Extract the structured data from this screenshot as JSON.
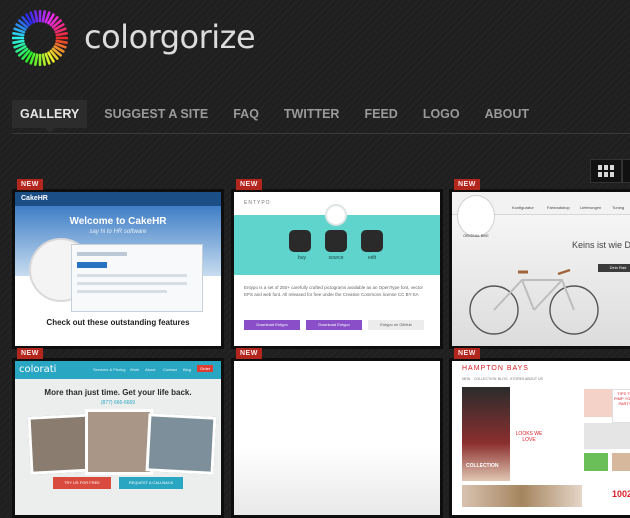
{
  "site": {
    "title": "colorgorize"
  },
  "nav": {
    "items": [
      {
        "label": "GALLERY",
        "active": true
      },
      {
        "label": "SUGGEST A SITE"
      },
      {
        "label": "FAQ"
      },
      {
        "label": "TWITTER"
      },
      {
        "label": "FEED"
      },
      {
        "label": "LOGO"
      },
      {
        "label": "ABOUT"
      }
    ]
  },
  "gallery": {
    "badge": "NEW",
    "items": [
      {
        "site": "CakeHR",
        "brand": "CakeHR",
        "heading": "Welcome to CakeHR",
        "tagline": "say hi to HR software",
        "caption": "Check out these outstanding features",
        "caption_highlight": "outstanding"
      },
      {
        "site": "Entypo",
        "nav": "ENTYPO",
        "labels": [
          "buy",
          "source",
          "edit"
        ],
        "body": "Entypo is a set of 250+ carefully crafted pictograms available as an OpenType font, vector EPS and web font. All released for free under the Creative Commons license CC BY-SA",
        "buttons": [
          "Download Entypo",
          "Download Entypo",
          "Entypo on GitHub"
        ]
      },
      {
        "site": "Keins ist wie Der",
        "headline": "Keins ist wie De",
        "menu": [
          "Konfigurator",
          "Fahrradshop",
          "Lieferungen",
          "Tuning"
        ],
        "button": "Dein Rad",
        "circle_text": "ORIGINAL BIKE"
      },
      {
        "site": "Colorati",
        "brand": "colorati",
        "nav": [
          "Services & Pricing",
          "Work",
          "About",
          "Contact",
          "Blog",
          "Order"
        ],
        "headline": "More than just time. Get your life back.",
        "phone": "(877) 666-6669",
        "buttons": [
          "TRY US FOR FREE",
          "REQUEST A CALLBACK"
        ]
      },
      {
        "site": "Blank",
        "blank": true
      },
      {
        "site": "Hampton Bays",
        "brand": "HAMPTON BAYS",
        "menu": [
          "NEW",
          "COLLECTION",
          "BLOG",
          "STORES",
          "ABOUT US"
        ],
        "promo": "TIPS TO PIMP YOUR PARTY",
        "looks": "LOOKS WE LOVE",
        "collection": "COLLECTION",
        "number": "1002"
      }
    ]
  },
  "icons": {
    "logo": "color-wheel-logo",
    "grid": "grid-view-icon"
  },
  "colors": {
    "background": "#1f1f1f",
    "badge": "#b3261e",
    "nav_active_bg": "#2c2c2c",
    "nav_text": "#9a9a9a",
    "cakehr_bg": "#ffffff",
    "entypo_teal": "#5fd4cc",
    "entypo_purple": "#8a4fc8",
    "colorati_teal": "#29a6c2",
    "hampton_red": "#d81e26"
  }
}
